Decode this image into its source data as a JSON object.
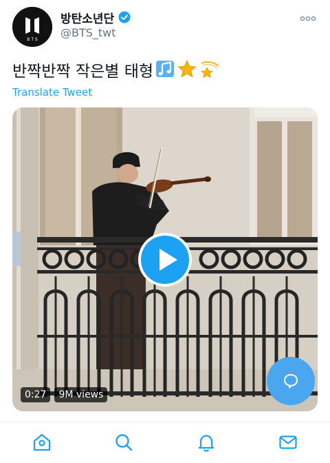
{
  "header": {
    "display_name": "방탄소년단",
    "handle": "@BTS_twt",
    "avatar_text": "B T S",
    "verified_icon": "verified-badge-icon",
    "more_icon": "more-dots-icon"
  },
  "tweet": {
    "text": "반짝반짝 작은별 태형",
    "emojis": [
      "music-notes-icon",
      "star-icon",
      "dizzy-star-icon"
    ],
    "translate_label": "Translate Tweet"
  },
  "video": {
    "duration": "0:27",
    "views": "9M views",
    "play_icon": "play-icon"
  },
  "fab": {
    "icon": "compose-reply-icon"
  },
  "bottom_nav": {
    "items": [
      {
        "name": "home",
        "icon": "home-icon"
      },
      {
        "name": "search",
        "icon": "search-icon"
      },
      {
        "name": "notifications",
        "icon": "bell-icon"
      },
      {
        "name": "messages",
        "icon": "mail-icon"
      }
    ]
  },
  "colors": {
    "accent": "#1da1f2",
    "text": "#14171a",
    "muted": "#657786",
    "nav_icon": "#1da1f2"
  }
}
